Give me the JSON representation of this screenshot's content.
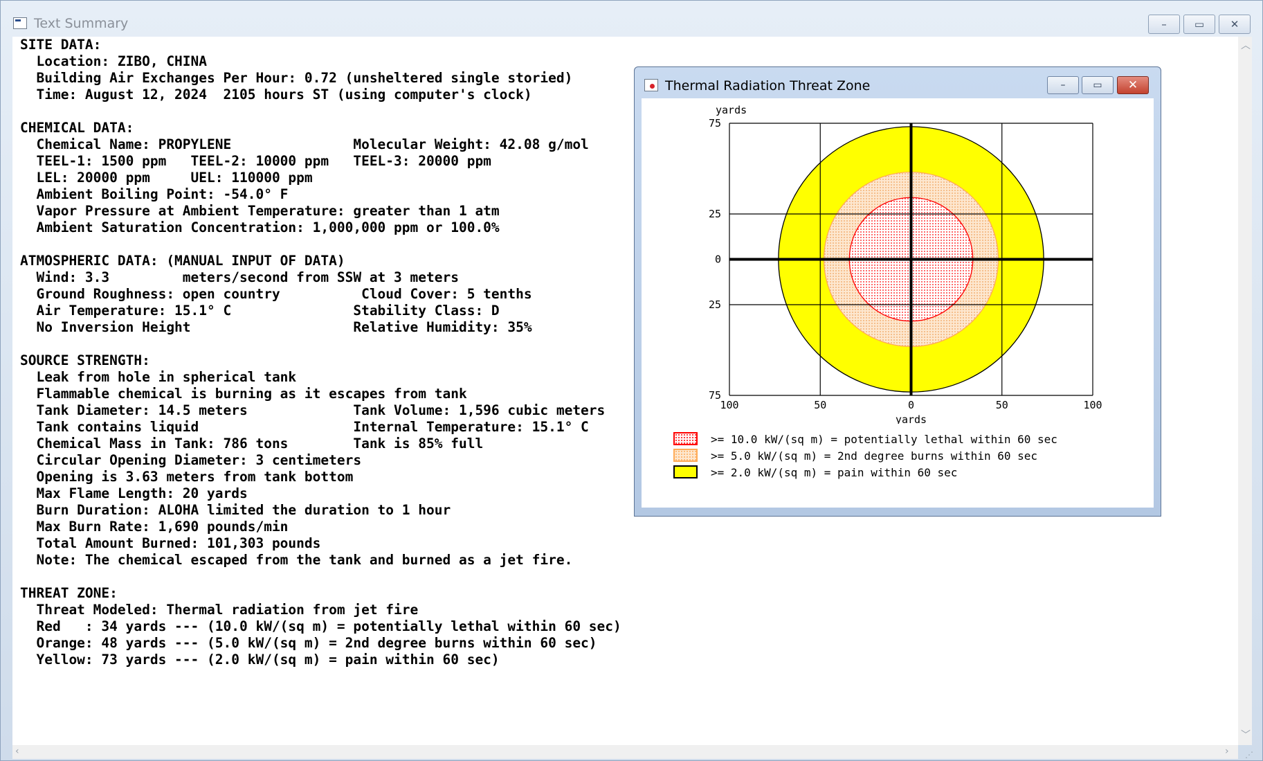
{
  "window": {
    "title": "Text Summary",
    "minimize_glyph": "–",
    "maximize_glyph": "▭",
    "close_glyph": "✕"
  },
  "summary_lines": [
    "SITE DATA:",
    "  Location: ZIBO, CHINA",
    "  Building Air Exchanges Per Hour: 0.72 (unsheltered single storied)",
    "  Time: August 12, 2024  2105 hours ST (using computer's clock)",
    "",
    "CHEMICAL DATA:",
    "  Chemical Name: PROPYLENE               Molecular Weight: 42.08 g/mol",
    "  TEEL-1: 1500 ppm   TEEL-2: 10000 ppm   TEEL-3: 20000 ppm",
    "  LEL: 20000 ppm     UEL: 110000 ppm",
    "  Ambient Boiling Point: -54.0° F",
    "  Vapor Pressure at Ambient Temperature: greater than 1 atm",
    "  Ambient Saturation Concentration: 1,000,000 ppm or 100.0%",
    "",
    "ATMOSPHERIC DATA: (MANUAL INPUT OF DATA)",
    "  Wind: 3.3         meters/second from SSW at 3 meters",
    "  Ground Roughness: open country          Cloud Cover: 5 tenths",
    "  Air Temperature: 15.1° C               Stability Class: D",
    "  No Inversion Height                    Relative Humidity: 35%",
    "",
    "SOURCE STRENGTH:",
    "  Leak from hole in spherical tank",
    "  Flammable chemical is burning as it escapes from tank",
    "  Tank Diameter: 14.5 meters             Tank Volume: 1,596 cubic meters",
    "  Tank contains liquid                   Internal Temperature: 15.1° C",
    "  Chemical Mass in Tank: 786 tons        Tank is 85% full",
    "  Circular Opening Diameter: 3 centimeters",
    "  Opening is 3.63 meters from tank bottom",
    "  Max Flame Length: 20 yards",
    "  Burn Duration: ALOHA limited the duration to 1 hour",
    "  Max Burn Rate: 1,690 pounds/min",
    "  Total Amount Burned: 101,303 pounds",
    "  Note: The chemical escaped from the tank and burned as a jet fire.",
    "",
    "THREAT ZONE:",
    "  Threat Modeled: Thermal radiation from jet fire",
    "  Red   : 34 yards --- (10.0 kW/(sq m) = potentially lethal within 60 sec)",
    "  Orange: 48 yards --- (5.0 kW/(sq m) = 2nd degree burns within 60 sec)",
    "  Yellow: 73 yards --- (2.0 kW/(sq m) = pain within 60 sec)"
  ],
  "threat_window": {
    "title": "Thermal Radiation Threat Zone",
    "minimize_glyph": "–",
    "maximize_glyph": "▭",
    "close_glyph": "✕"
  },
  "colors": {
    "red": "#ff0000",
    "orange": "#ffaa55",
    "orange_fill": "#fde7cf",
    "yellow": "#ffff00",
    "red_fill": "#fff4f4"
  },
  "chart_data": {
    "type": "threat-zone-plot",
    "x_unit_label": "yards",
    "y_unit_label": "yards",
    "xlim": [
      -100,
      100
    ],
    "ylim": [
      -75,
      75
    ],
    "x_ticks": [
      {
        "value": -100,
        "label": "100"
      },
      {
        "value": -50,
        "label": "50"
      },
      {
        "value": 0,
        "label": "0"
      },
      {
        "value": 50,
        "label": "50"
      },
      {
        "value": 100,
        "label": "100"
      }
    ],
    "y_ticks": [
      {
        "value": 75,
        "label": "75"
      },
      {
        "value": 25,
        "label": "25"
      },
      {
        "value": 0,
        "label": "0"
      },
      {
        "value": -25,
        "label": "25"
      },
      {
        "value": -75,
        "label": "75"
      }
    ],
    "grid": true,
    "zones": [
      {
        "name": "yellow",
        "radius": 73,
        "color": "#ffff00",
        "stroke": "#000000"
      },
      {
        "name": "orange",
        "radius": 48,
        "color": "#fde7cf",
        "stroke": "#ffaa55"
      },
      {
        "name": "red",
        "radius": 34,
        "color": "#fff4f4",
        "stroke": "#ff0000"
      }
    ],
    "legend": [
      {
        "label": ">= 10.0 kW/(sq m) = potentially lethal within 60 sec",
        "swatch_fill": "#fff4f4",
        "swatch_border": "#ff0000",
        "dotted": true
      },
      {
        "label": ">= 5.0 kW/(sq m) = 2nd degree burns within 60 sec",
        "swatch_fill": "#fde7cf",
        "swatch_border": "#ffaa55",
        "dotted": true
      },
      {
        "label": ">= 2.0 kW/(sq m) = pain within 60 sec",
        "swatch_fill": "#ffff00",
        "swatch_border": "#000000",
        "dotted": false
      }
    ],
    "legend_position": "bottom"
  }
}
